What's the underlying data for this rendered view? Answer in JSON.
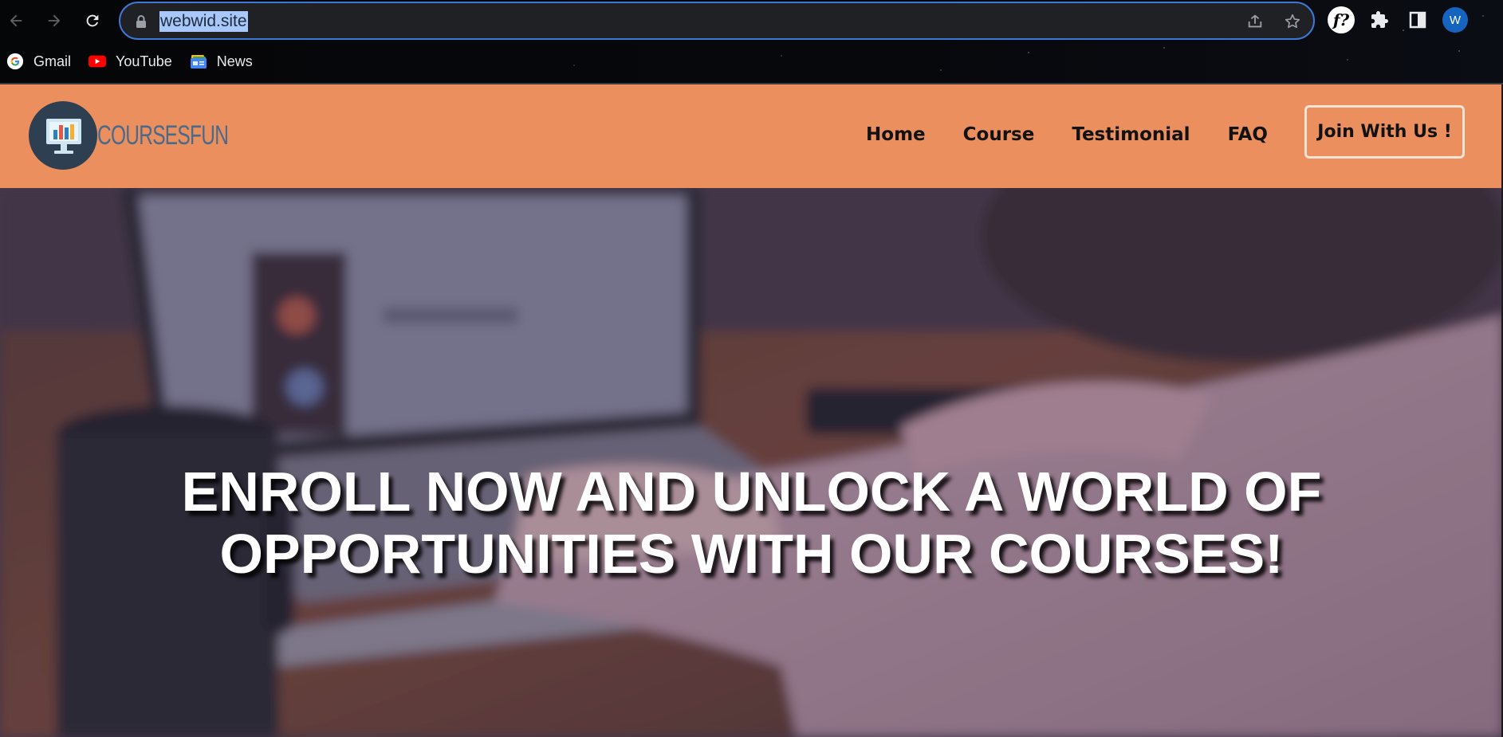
{
  "browser": {
    "url": "webwid.site",
    "toolbar_icons": [
      "back-arrow-icon",
      "forward-arrow-icon",
      "reload-icon",
      "lock-icon",
      "share-icon",
      "star-icon",
      "extension-f-icon",
      "puzzle-icon",
      "side-panel-icon"
    ],
    "extension_f_label": "f?",
    "profile_initial": "W",
    "bookmarks": [
      {
        "label": "Gmail",
        "icon": "google-icon"
      },
      {
        "label": "YouTube",
        "icon": "youtube-icon"
      },
      {
        "label": "News",
        "icon": "news-icon"
      }
    ]
  },
  "site": {
    "logo_text": "COURSESFUN",
    "nav": [
      "Home",
      "Course",
      "Testimonial",
      "FAQ"
    ],
    "cta_label": "Join With Us !",
    "header_color": "#ec8f5e"
  },
  "hero": {
    "title_line1": "ENROLL NOW AND UNLOCK A WORLD OF",
    "title_line2": "OPPORTUNITIES WITH OUR COURSES!"
  }
}
